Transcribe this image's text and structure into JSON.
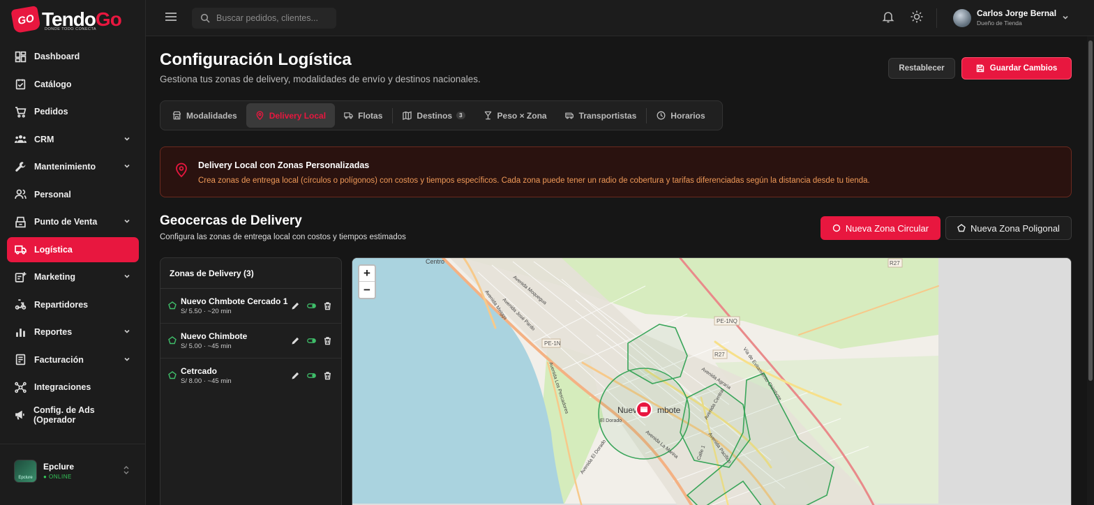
{
  "brand": {
    "name_part1": "Tendo",
    "name_part2": "Go",
    "badge": "GO",
    "tagline": "DONDE TODO CONECTA"
  },
  "sidebar": {
    "items": [
      {
        "label": "Dashboard",
        "icon": "dashboard-icon",
        "expandable": false
      },
      {
        "label": "Catálogo",
        "icon": "catalog-icon",
        "expandable": false
      },
      {
        "label": "Pedidos",
        "icon": "cart-icon",
        "expandable": false
      },
      {
        "label": "CRM",
        "icon": "users-icon",
        "expandable": true
      },
      {
        "label": "Mantenimiento",
        "icon": "wrench-icon",
        "expandable": true
      },
      {
        "label": "Personal",
        "icon": "person-icon",
        "expandable": false
      },
      {
        "label": "Punto de Venta",
        "icon": "register-icon",
        "expandable": true
      },
      {
        "label": "Logística",
        "icon": "truck-icon",
        "expandable": false,
        "active": true
      },
      {
        "label": "Marketing",
        "icon": "marketing-icon",
        "expandable": true
      },
      {
        "label": "Repartidores",
        "icon": "scooter-icon",
        "expandable": false
      },
      {
        "label": "Reportes",
        "icon": "bar-chart-icon",
        "expandable": true
      },
      {
        "label": "Facturación",
        "icon": "invoice-icon",
        "expandable": true
      },
      {
        "label": "Integraciones",
        "icon": "hub-icon",
        "expandable": false
      },
      {
        "label": "Config. de Ads (Operador",
        "icon": "megaphone-icon",
        "expandable": false
      }
    ],
    "store": {
      "name": "Epclure",
      "status": "● ONLINE",
      "avatar_label": "Epclure"
    }
  },
  "topbar": {
    "search_placeholder": "Buscar pedidos, clientes...",
    "user_name": "Carlos Jorge Bernal",
    "user_role": "Dueño de Tienda"
  },
  "page": {
    "title": "Configuración Logística",
    "subtitle": "Gestiona tus zonas de delivery, modalidades de envío y destinos nacionales.",
    "reset_label": "Restablecer",
    "save_label": "Guardar Cambios"
  },
  "tabs": [
    {
      "label": "Modalidades",
      "icon": "store-icon"
    },
    {
      "label": "Delivery Local",
      "icon": "map-pin-icon",
      "active": true
    },
    {
      "label": "Flotas",
      "icon": "truck-icon"
    },
    {
      "label": "Destinos",
      "icon": "map-icon",
      "badge": "3"
    },
    {
      "label": "Peso × Zona",
      "icon": "scale-icon"
    },
    {
      "label": "Transportistas",
      "icon": "bus-icon"
    },
    {
      "label": "Horarios",
      "icon": "clock-icon"
    }
  ],
  "alert": {
    "title": "Delivery Local con Zonas Personalizadas",
    "text": "Crea zonas de entrega local (círculos o polígonos) con costos y tiempos específicos. Cada zona puede tener un radio de cobertura y tarifas diferenciadas según la distancia desde tu tienda."
  },
  "geofences": {
    "title": "Geocercas de Delivery",
    "subtitle": "Configura las zonas de entrega local con costos y tiempos estimados",
    "btn_circle": "Nueva Zona Circular",
    "btn_polygon": "Nueva Zona Poligonal",
    "list_title": "Zonas de Delivery (3)",
    "zones": [
      {
        "name": "Nuevo Chmbote Cercado 1",
        "meta": "S/ 5.50 · ~20 min"
      },
      {
        "name": "Nuevo Chimbote",
        "meta": "S/ 5.00 · ~45 min"
      },
      {
        "name": "Cetrcado",
        "meta": "S/ 8.00 · ~45 min"
      }
    ]
  },
  "map": {
    "zoom_in": "+",
    "zoom_out": "−",
    "labels": {
      "centro": "Centro",
      "pe1n": "PE-1N",
      "pe1nq": "PE-1NQ",
      "r27a": "R27",
      "r27b": "R27",
      "city_left": "Nuevo C",
      "city_right": "mbote",
      "el_dorado": "El Dorado",
      "av_jose_pardo": "Avenida José Pardo",
      "av_meiggs": "Avenida Meiggs",
      "av_pescadores": "Avenida Los Pescadores",
      "av_agraria": "Avenida Agraria",
      "av_central": "Avenida Central",
      "av_pacifico": "Avenida Pacífico",
      "via_evitamiento": "Vía de Evitamiento Chimbote",
      "av_la_marina": "Avenida La Marina",
      "av_el_dorado": "Avenida El Dorado",
      "av_moquegua": "Avenida Moquegua",
      "calle_1": "Calle 1"
    },
    "colors": {
      "water": "#aad3df",
      "land": "#f2efe9",
      "park": "#cdebb0",
      "zone": "#3aa55a",
      "road": "#f7c98a",
      "marker": "#e8173f"
    }
  }
}
